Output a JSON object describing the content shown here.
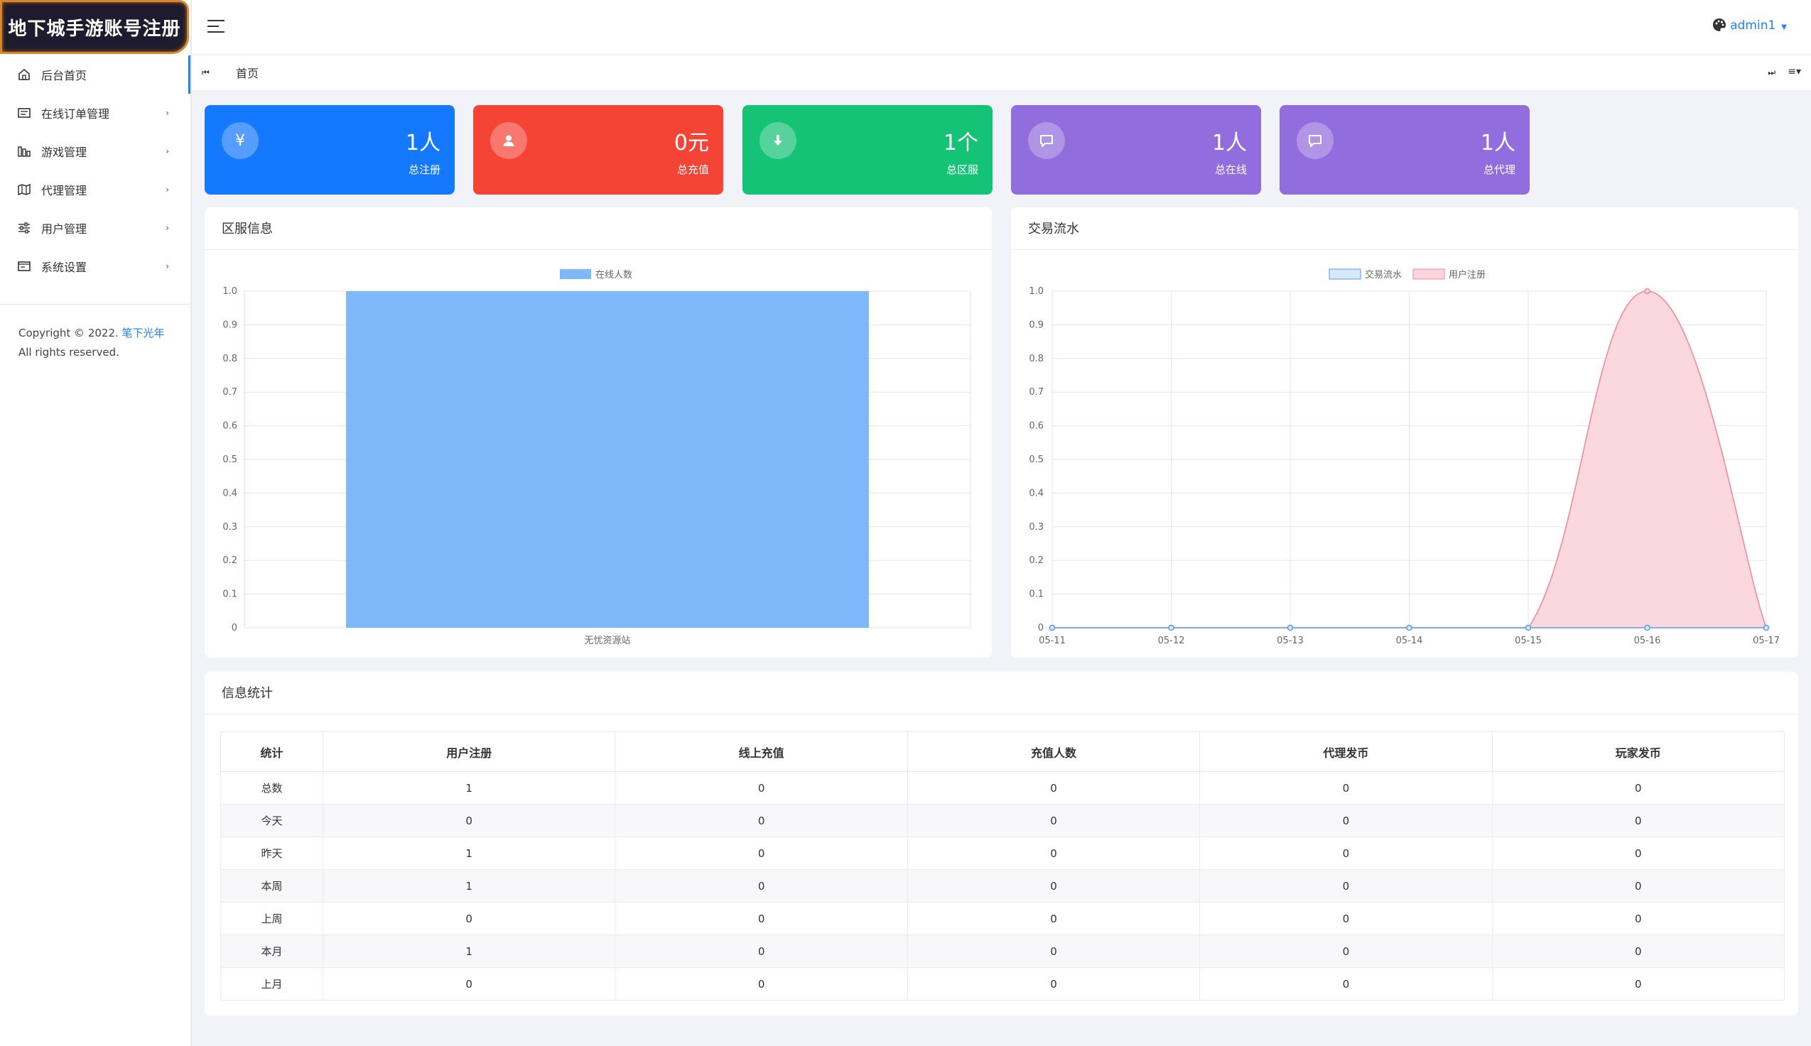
{
  "app": {
    "logo_text": "地下城手游账号注册"
  },
  "sidebar": {
    "items": [
      {
        "label": "后台首页",
        "icon": "home-icon",
        "has_children": false
      },
      {
        "label": "在线订单管理",
        "icon": "order-icon",
        "has_children": true
      },
      {
        "label": "游戏管理",
        "icon": "game-icon",
        "has_children": true
      },
      {
        "label": "代理管理",
        "icon": "agent-icon",
        "has_children": true
      },
      {
        "label": "用户管理",
        "icon": "sliders-icon",
        "has_children": true
      },
      {
        "label": "系统设置",
        "icon": "settings-icon",
        "has_children": true
      }
    ],
    "copyright_prefix": "Copyright © 2022. ",
    "copyright_link": "笔下光年",
    "copyright_suffix": "All rights reserved."
  },
  "header": {
    "user": "admin1",
    "theme_icon": "palette-icon",
    "menu_icon": "hamburger-icon"
  },
  "tabs": {
    "items": [
      "首页"
    ],
    "prev_icon": "skip-back-icon",
    "next_icon": "skip-forward-icon",
    "options_icon": "list-menu-icon"
  },
  "cards": [
    {
      "value": "1人",
      "label": "总注册",
      "icon": "yen-icon",
      "color": "#1479ff"
    },
    {
      "value": "0元",
      "label": "总充值",
      "icon": "user-icon",
      "color": "#f54336"
    },
    {
      "value": "1个",
      "label": "总区服",
      "icon": "download-icon",
      "color": "#15c377"
    },
    {
      "value": "1人",
      "label": "总在线",
      "icon": "message-icon",
      "color": "#926dde"
    },
    {
      "value": "1人",
      "label": "总代理",
      "icon": "message-icon",
      "color": "#926dde"
    }
  ],
  "panels": {
    "server_info": {
      "title": "区服信息"
    },
    "transactions": {
      "title": "交易流水"
    },
    "stats": {
      "title": "信息统计"
    }
  },
  "chart_data": [
    {
      "type": "bar",
      "categories": [
        "无忧资源站"
      ],
      "series": [
        {
          "name": "在线人数",
          "values": [
            1
          ],
          "color": "#7fb8fa"
        }
      ],
      "ylim": [
        0,
        1.0
      ],
      "yticks": [
        "1.0",
        "0.9",
        "0.8",
        "0.7",
        "0.6",
        "0.5",
        "0.4",
        "0.3",
        "0.2",
        "0.1",
        "0"
      ],
      "grid": true,
      "legend": "top-center"
    },
    {
      "type": "area",
      "x": [
        "05-11",
        "05-12",
        "05-13",
        "05-14",
        "05-15",
        "05-16",
        "05-17"
      ],
      "series": [
        {
          "name": "交易流水",
          "values": [
            0,
            0,
            0,
            0,
            0,
            0,
            0
          ],
          "color": "#5b9bf0",
          "fill": "#d6e8fb"
        },
        {
          "name": "用户注册",
          "values": [
            0,
            0,
            0,
            0,
            0,
            1,
            0
          ],
          "color": "#f28aa0",
          "fill": "#fbd4dc"
        }
      ],
      "ylim": [
        0,
        1.0
      ],
      "yticks": [
        "1.0",
        "0.9",
        "0.8",
        "0.7",
        "0.6",
        "0.5",
        "0.4",
        "0.3",
        "0.2",
        "0.1",
        "0"
      ],
      "grid": true,
      "legend": "top-center"
    }
  ],
  "stats_table": {
    "headers": [
      "统计",
      "用户注册",
      "线上充值",
      "充值人数",
      "代理发币",
      "玩家发币"
    ],
    "rows": [
      [
        "总数",
        "1",
        "0",
        "0",
        "0",
        "0"
      ],
      [
        "今天",
        "0",
        "0",
        "0",
        "0",
        "0"
      ],
      [
        "昨天",
        "1",
        "0",
        "0",
        "0",
        "0"
      ],
      [
        "本周",
        "1",
        "0",
        "0",
        "0",
        "0"
      ],
      [
        "上周",
        "0",
        "0",
        "0",
        "0",
        "0"
      ],
      [
        "本月",
        "1",
        "0",
        "0",
        "0",
        "0"
      ],
      [
        "上月",
        "0",
        "0",
        "0",
        "0",
        "0"
      ]
    ]
  }
}
